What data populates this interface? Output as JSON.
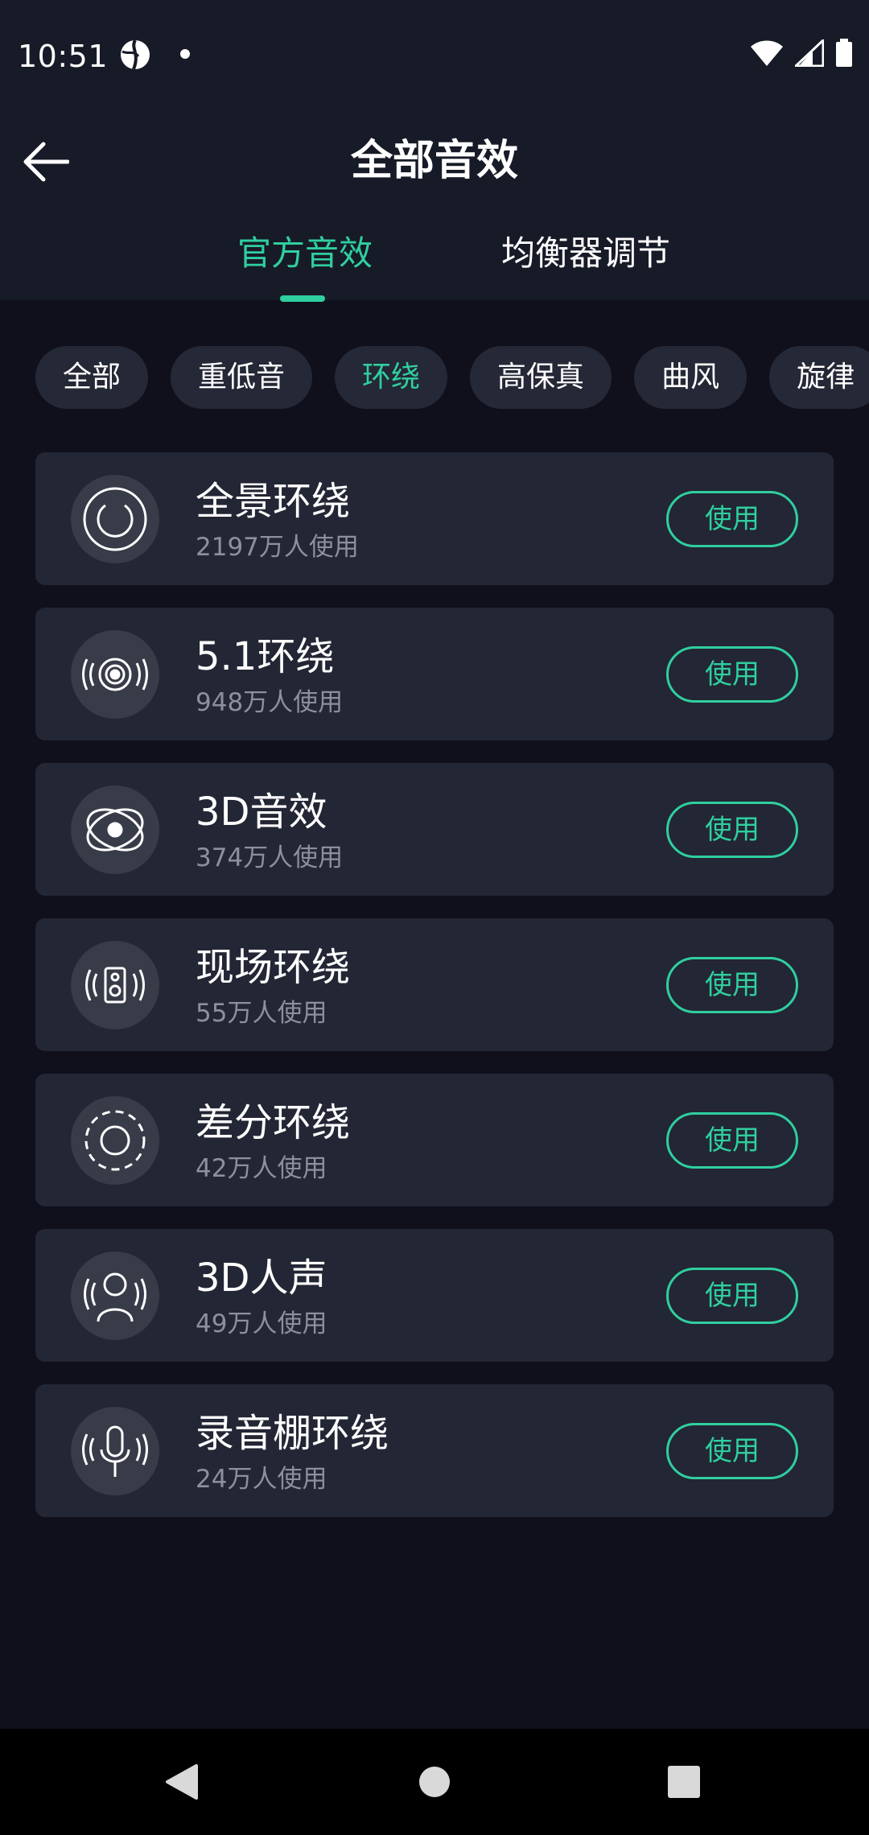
{
  "status_bar": {
    "time": "10:51",
    "icons": [
      "app-notification-icon",
      "dot-icon",
      "wifi-icon",
      "signal-icon",
      "battery-icon"
    ]
  },
  "header": {
    "title": "全部音效",
    "back_icon": "arrow-left-icon"
  },
  "tabs": [
    {
      "label": "官方音效",
      "active": true
    },
    {
      "label": "均衡器调节",
      "active": false
    }
  ],
  "chips": [
    {
      "label": "全部",
      "active": false
    },
    {
      "label": "重低音",
      "active": false
    },
    {
      "label": "环绕",
      "active": true
    },
    {
      "label": "高保真",
      "active": false
    },
    {
      "label": "曲风",
      "active": false
    },
    {
      "label": "旋律",
      "active": false
    }
  ],
  "effects": [
    {
      "name": "全景环绕",
      "users": "2197万人使用",
      "icon": "panorama-ring-icon",
      "button": "使用"
    },
    {
      "name": "5.1环绕",
      "users": "948万人使用",
      "icon": "speaker-waves-icon",
      "button": "使用"
    },
    {
      "name": "3D音效",
      "users": "374万人使用",
      "icon": "orbit-3d-icon",
      "button": "使用"
    },
    {
      "name": "现场环绕",
      "users": "55万人使用",
      "icon": "live-speaker-icon",
      "button": "使用"
    },
    {
      "name": "差分环绕",
      "users": "42万人使用",
      "icon": "dashed-ring-icon",
      "button": "使用"
    },
    {
      "name": "3D人声",
      "users": "49万人使用",
      "icon": "person-waves-icon",
      "button": "使用"
    },
    {
      "name": "录音棚环绕",
      "users": "24万人使用",
      "icon": "microphone-waves-icon",
      "button": "使用"
    }
  ],
  "colors": {
    "accent": "#2fcf9f",
    "background": "#0f101b",
    "header": "#171a27",
    "card": "#232634",
    "chip": "#252836",
    "secondary_text": "#8d909c"
  },
  "navbar": {
    "icons": [
      "nav-back-icon",
      "nav-home-icon",
      "nav-recents-icon"
    ]
  }
}
